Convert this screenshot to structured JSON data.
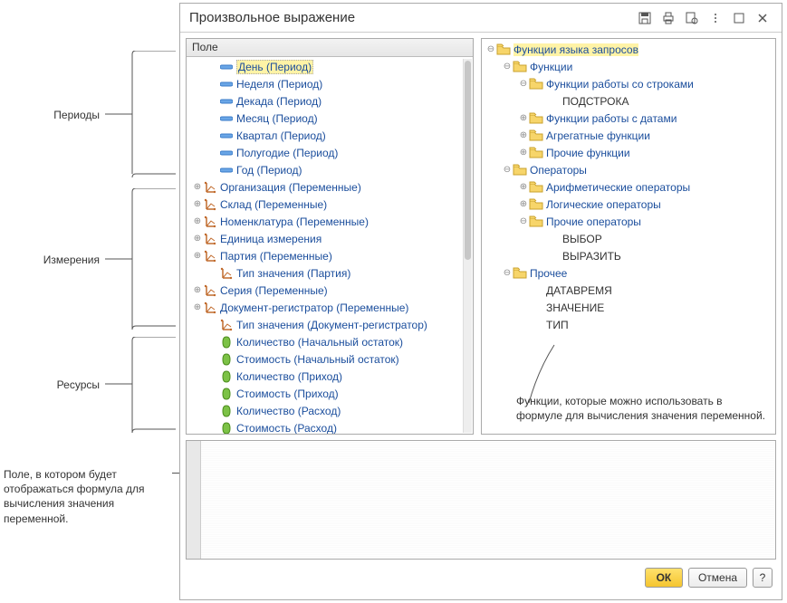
{
  "title": "Произвольное выражение",
  "columns": {
    "field": "Поле"
  },
  "annotations": {
    "periods": "Периоды",
    "dimensions": "Измерения",
    "resources": "Ресурсы",
    "formula_field": "Поле, в котором будет отображаться формула для вычисления значения переменной."
  },
  "left_tree": [
    {
      "indent": 1,
      "icon": "period",
      "label": "День (Период)",
      "selected": true
    },
    {
      "indent": 1,
      "icon": "period",
      "label": "Неделя (Период)"
    },
    {
      "indent": 1,
      "icon": "period",
      "label": "Декада (Период)"
    },
    {
      "indent": 1,
      "icon": "period",
      "label": "Месяц (Период)"
    },
    {
      "indent": 1,
      "icon": "period",
      "label": "Квартал (Период)"
    },
    {
      "indent": 1,
      "icon": "period",
      "label": "Полугодие (Период)"
    },
    {
      "indent": 1,
      "icon": "period",
      "label": "Год (Период)"
    },
    {
      "indent": 0,
      "exp": "+",
      "icon": "dim",
      "label": "Организация (Переменные)"
    },
    {
      "indent": 0,
      "exp": "+",
      "icon": "dim",
      "label": "Склад (Переменные)"
    },
    {
      "indent": 0,
      "exp": "+",
      "icon": "dim",
      "label": "Номенклатура (Переменные)"
    },
    {
      "indent": 0,
      "exp": "+",
      "icon": "dim",
      "label": "Единица измерения"
    },
    {
      "indent": 0,
      "exp": "+",
      "icon": "dim",
      "label": "Партия (Переменные)"
    },
    {
      "indent": 1,
      "icon": "dim",
      "label": "Тип значения (Партия)"
    },
    {
      "indent": 0,
      "exp": "+",
      "icon": "dim",
      "label": "Серия (Переменные)"
    },
    {
      "indent": 0,
      "exp": "+",
      "icon": "dim",
      "label": "Документ-регистратор (Переменные)"
    },
    {
      "indent": 1,
      "icon": "dim",
      "label": "Тип значения (Документ-регистратор)"
    },
    {
      "indent": 1,
      "icon": "res",
      "label": "Количество (Начальный остаток)"
    },
    {
      "indent": 1,
      "icon": "res",
      "label": "Стоимость (Начальный остаток)"
    },
    {
      "indent": 1,
      "icon": "res",
      "label": "Количество (Приход)"
    },
    {
      "indent": 1,
      "icon": "res",
      "label": "Стоимость (Приход)"
    },
    {
      "indent": 1,
      "icon": "res",
      "label": "Количество (Расход)"
    },
    {
      "indent": 1,
      "icon": "res",
      "label": "Стоимость (Расход)"
    }
  ],
  "right_tree": [
    {
      "indent": 0,
      "exp": "-",
      "icon": "folder",
      "label": "Функции языка запросов",
      "hl": true
    },
    {
      "indent": 1,
      "exp": "-",
      "icon": "folder",
      "label": "Функции"
    },
    {
      "indent": 2,
      "exp": "-",
      "icon": "folder",
      "label": "Функции работы со строками"
    },
    {
      "indent": 3,
      "icon": "none",
      "label": "ПОДСТРОКА",
      "black": true
    },
    {
      "indent": 2,
      "exp": "+",
      "icon": "folder",
      "label": "Функции работы с датами"
    },
    {
      "indent": 2,
      "exp": "+",
      "icon": "folder",
      "label": "Агрегатные функции"
    },
    {
      "indent": 2,
      "exp": "+",
      "icon": "folder",
      "label": "Прочие функции"
    },
    {
      "indent": 1,
      "exp": "-",
      "icon": "folder",
      "label": "Операторы"
    },
    {
      "indent": 2,
      "exp": "+",
      "icon": "folder",
      "label": "Арифметические операторы"
    },
    {
      "indent": 2,
      "exp": "+",
      "icon": "folder",
      "label": "Логические операторы"
    },
    {
      "indent": 2,
      "exp": "-",
      "icon": "folder",
      "label": "Прочие операторы"
    },
    {
      "indent": 3,
      "icon": "none",
      "label": "ВЫБОР",
      "black": true
    },
    {
      "indent": 3,
      "icon": "none",
      "label": "ВЫРАЗИТЬ",
      "black": true
    },
    {
      "indent": 1,
      "exp": "-",
      "icon": "folder",
      "label": "Прочее"
    },
    {
      "indent": 2,
      "icon": "none",
      "label": "ДАТАВРЕМЯ",
      "black": true
    },
    {
      "indent": 2,
      "icon": "none",
      "label": "ЗНАЧЕНИЕ",
      "black": true
    },
    {
      "indent": 2,
      "icon": "none",
      "label": "ТИП",
      "black": true
    }
  ],
  "right_desc": "Функции, которые можно использовать в формуле для вычисления значения переменной.",
  "buttons": {
    "ok": "ОК",
    "cancel": "Отмена",
    "help": "?"
  }
}
